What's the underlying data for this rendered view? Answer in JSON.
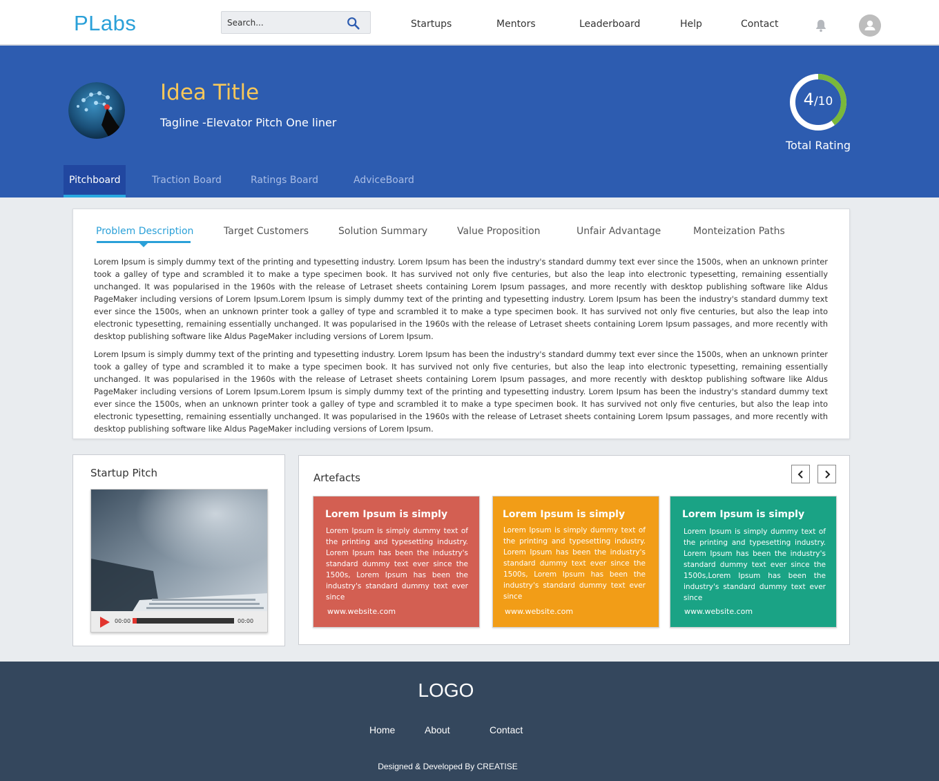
{
  "header": {
    "brand": "PLabs",
    "search_placeholder": "Search...",
    "nav": [
      "Startups",
      "Mentors",
      "Leaderboard",
      "Help",
      "Contact"
    ],
    "icons": [
      "search-icon",
      "bell-icon",
      "user-avatar-icon"
    ]
  },
  "hero": {
    "title": "Idea Title",
    "tagline": "Tagline  -Elevator Pitch One liner",
    "rating": {
      "value": "4",
      "max": "/10",
      "fraction": 0.4,
      "label": "Total Rating"
    },
    "tabs": [
      "Pitchboard",
      "Traction Board",
      "Ratings Board",
      "AdviceBoard"
    ],
    "active_tab": "Pitchboard",
    "colors": {
      "background": "#2d5cb0",
      "title": "#f6c75a",
      "ring": "#7ab83b"
    }
  },
  "pitchboard": {
    "tabs": [
      "Problem Description",
      "Target Customers",
      "Solution Summary",
      "Value Proposition",
      "Unfair Advantage",
      "Monteization Paths"
    ],
    "active_tab": "Problem Description",
    "paragraphs": [
      "Lorem Ipsum is simply dummy text of the printing and typesetting industry. Lorem Ipsum has been the industry's standard dummy text ever since the 1500s, when an unknown printer took a galley of type and scrambled it to make a type specimen book. It has survived not only five centuries, but also the leap into electronic typesetting, remaining essentially unchanged. It was popularised in the 1960s with the release of Letraset sheets containing Lorem Ipsum passages, and more recently with desktop publishing software like Aldus PageMaker including versions of Lorem Ipsum.Lorem Ipsum is simply dummy text of the printing and typesetting industry. Lorem Ipsum has been the industry's standard dummy text ever since the 1500s, when an unknown printer took a galley of type and scrambled it to make a type specimen book. It has survived not only five centuries, but also the leap into electronic typesetting, remaining essentially unchanged. It was popularised in the 1960s with the release of Letraset sheets containing Lorem Ipsum passages, and more recently with desktop publishing software like Aldus PageMaker including versions of Lorem Ipsum.",
      "Lorem Ipsum is simply dummy text of the printing and typesetting industry. Lorem Ipsum has been the industry's standard dummy text ever since the 1500s, when an unknown printer took a galley of type and scrambled it to make a type specimen book. It has survived not only five centuries, but also the leap into electronic typesetting, remaining essentially unchanged. It was popularised in the 1960s with the release of Letraset sheets containing Lorem Ipsum passages, and more recently with desktop publishing software like Aldus PageMaker including versions of Lorem Ipsum.Lorem Ipsum is simply dummy text of the printing and typesetting industry. Lorem Ipsum has been the industry's standard dummy text ever since the 1500s, when an unknown printer took a galley of type and scrambled it to make a type specimen book. It has survived not only five centuries, but also the leap into electronic typesetting, remaining essentially unchanged. It was popularised in the 1960s with the release of Letraset sheets containing Lorem Ipsum passages, and more recently with desktop publishing software like Aldus PageMaker including versions of Lorem Ipsum."
    ]
  },
  "pitch": {
    "title": "Startup Pitch",
    "time_current": "00:00",
    "time_total": "00:00",
    "progress": 0.04
  },
  "artefacts": {
    "title": "Artefacts",
    "cards": [
      {
        "title": "Lorem Ipsum is simply",
        "body": "Lorem Ipsum is simply dummy text of the printing and typesetting industry. Lorem Ipsum has been the industry's standard dummy text ever since the 1500s, Lorem Ipsum has been the industry's standard dummy text ever since",
        "url": "www.website.com",
        "color": "#d35f52"
      },
      {
        "title": "Lorem Ipsum is simply",
        "body": "Lorem Ipsum is simply dummy text of the printing and typesetting industry. Lorem Ipsum has been the industry's standard dummy text ever since the 1500s, Lorem Ipsum has been the industry's standard dummy text ever since",
        "url": "www.website.com",
        "color": "#f29d17"
      },
      {
        "title": "Lorem Ipsum is simply",
        "body": "Lorem Ipsum is simply dummy text of the printing and typesetting industry. Lorem Ipsum has been the industry's standard dummy text ever since the 1500s,Lorem Ipsum has been the industry's standard dummy text ever since",
        "url": "www.website.com",
        "color": "#1aa385"
      }
    ]
  },
  "footer": {
    "logo": "LOGO",
    "links": [
      "Home",
      "About",
      "Contact"
    ],
    "credit": "Designed & Developed By CREATISE",
    "color": "#34475d"
  }
}
